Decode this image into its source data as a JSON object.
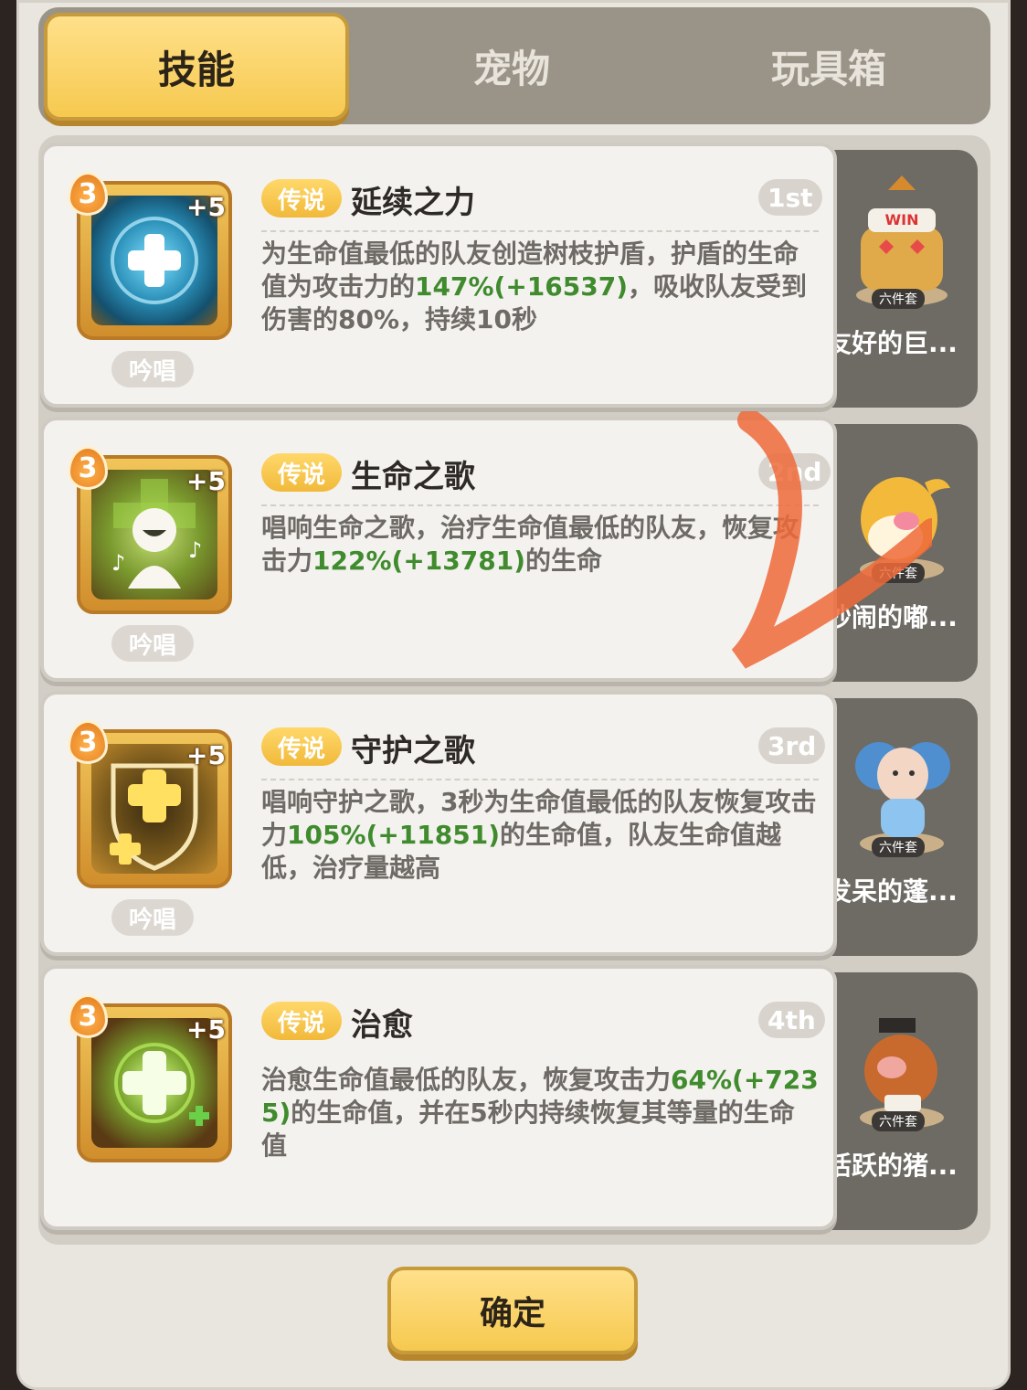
{
  "tabs": [
    {
      "label": "技能",
      "active": true
    },
    {
      "label": "宠物",
      "active": false
    },
    {
      "label": "玩具箱",
      "active": false
    }
  ],
  "skills": [
    {
      "level": "3",
      "bonus": "+5",
      "cast_type": "吟唱",
      "rarity": "传说",
      "name": "延续之力",
      "rank": "1st",
      "desc_parts": [
        "为生命值最低的队友创造树枝护盾，护盾的生命值为攻击力的",
        "147%(+16537)",
        "，吸收队友受到伤害的80%，持续10秒"
      ],
      "icon": "heal-cross-orb-icon",
      "pet": {
        "name": "友好的巨...",
        "badge": "六件套",
        "icon": "golem-pet-icon"
      }
    },
    {
      "level": "3",
      "bonus": "+5",
      "cast_type": "吟唱",
      "rarity": "传说",
      "name": "生命之歌",
      "rank": "2nd",
      "desc_parts": [
        "唱响生命之歌，治疗生命值最低的队友，恢复攻击力",
        "122%(+13781)",
        "的生命"
      ],
      "icon": "singer-icon",
      "pet": {
        "name": "吵闹的嘟...",
        "badge": "六件套",
        "icon": "bird-pet-icon"
      }
    },
    {
      "level": "3",
      "bonus": "+5",
      "cast_type": "吟唱",
      "rarity": "传说",
      "name": "守护之歌",
      "rank": "3rd",
      "desc_parts": [
        "唱响守护之歌，3秒为生命值最低的队友恢复攻击力",
        "105%(+11851)",
        "的生命值，队友生命值越低，治疗量越高"
      ],
      "icon": "shield-cross-icon",
      "pet": {
        "name": "发呆的蓬...",
        "badge": "六件套",
        "icon": "sheep-pet-icon"
      }
    },
    {
      "level": "3",
      "bonus": "+5",
      "cast_type": "",
      "rarity": "传说",
      "name": "治愈",
      "rank": "4th",
      "desc_parts": [
        "治愈生命值最低的队友，恢复攻击力",
        "64%(+7235)",
        "的生命值，并在5秒内持续恢复其等量的生命值"
      ],
      "icon": "glowing-cross-icon",
      "pet": {
        "name": "活跃的猪...",
        "badge": "六件套",
        "icon": "boar-pet-icon"
      }
    }
  ],
  "confirm_label": "确定"
}
